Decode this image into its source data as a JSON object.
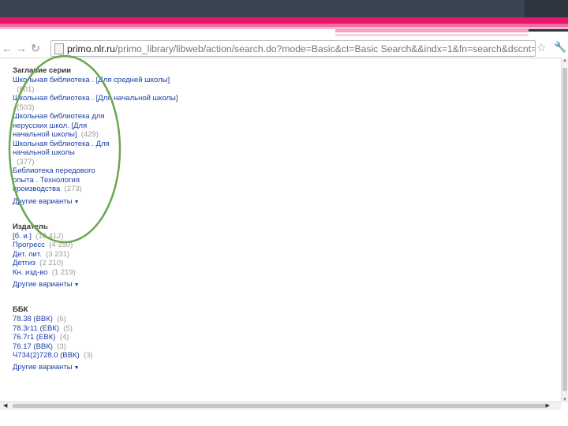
{
  "browser": {
    "url_host": "primo.nlr.ru",
    "url_path": "/primo_library/libweb/action/search.do?mode=Basic&ct=Basic Search&&indx=1&fn=search&dscnt=0&vl(1"
  },
  "facets": [
    {
      "title": "Заглавие серии",
      "items": [
        {
          "label": "Школьная библиотека . [Для средней школы]",
          "count": "(601)"
        },
        {
          "label": "Школьная библиотека . [Для начальной школы]",
          "count": "(503)"
        },
        {
          "label": "Школьная библиотека для нерусских школ. [Для начальной школы]",
          "count": "(429)"
        },
        {
          "label": "Школьная библиотека . Для начальной школы",
          "count": "(377)"
        },
        {
          "label": "Библиотека передового опыта . Технология производства",
          "count": "(273)"
        }
      ],
      "more": "Другие варианты"
    },
    {
      "title": "Издатель",
      "items": [
        {
          "label": "[б. и.]",
          "count": "(10 412)"
        },
        {
          "label": "Прогресс",
          "count": "(4 150)"
        },
        {
          "label": "Дет. лит.",
          "count": "(3 231)"
        },
        {
          "label": "Детгиз",
          "count": "(2 210)"
        },
        {
          "label": "Кн. изд-во",
          "count": "(1 219)"
        }
      ],
      "more": "Другие варианты"
    },
    {
      "title": "ББК",
      "items": [
        {
          "label": "78.38 (ВВК)",
          "count": "(6)"
        },
        {
          "label": "78.3г11 (ЕВК)",
          "count": "(5)"
        },
        {
          "label": "76.7г1 (ЕВК)",
          "count": "(4)"
        },
        {
          "label": "76.17 (ВВК)",
          "count": "(3)"
        },
        {
          "label": "Ч734(2)728.0 (ВВК)",
          "count": "(3)"
        }
      ],
      "more": "Другие варианты"
    }
  ],
  "colors": {
    "link": "#1a3fa8",
    "count": "#9a9a9a",
    "highlight": "#6aa84f",
    "accent_pink": "#e8176c"
  }
}
